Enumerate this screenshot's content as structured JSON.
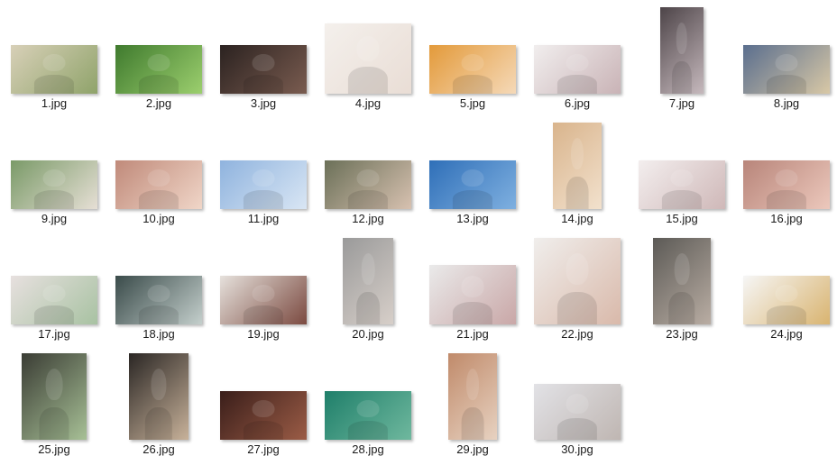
{
  "files": [
    {
      "name": "1.jpg",
      "orientation": "landscape",
      "colors": [
        "#d8d0b8",
        "#8fa36a"
      ]
    },
    {
      "name": "2.jpg",
      "orientation": "landscape",
      "colors": [
        "#3f7a2e",
        "#9ccf6e"
      ]
    },
    {
      "name": "3.jpg",
      "orientation": "landscape",
      "colors": [
        "#2b2220",
        "#7a5c50"
      ]
    },
    {
      "name": "4.jpg",
      "orientation": "landscape",
      "colors": [
        "#f4f0ec",
        "#e9ddd5"
      ]
    },
    {
      "name": "5.jpg",
      "orientation": "landscape",
      "colors": [
        "#e39a3a",
        "#f5d9b8"
      ]
    },
    {
      "name": "6.jpg",
      "orientation": "landscape",
      "colors": [
        "#f1eeee",
        "#c9b3b6"
      ]
    },
    {
      "name": "7.jpg",
      "orientation": "portrait",
      "colors": [
        "#4d4448",
        "#c6b9bd"
      ]
    },
    {
      "name": "8.jpg",
      "orientation": "landscape",
      "colors": [
        "#5a6e8e",
        "#d8c8a6"
      ]
    },
    {
      "name": "9.jpg",
      "orientation": "landscape",
      "colors": [
        "#7a9a68",
        "#e6dfd5"
      ]
    },
    {
      "name": "10.jpg",
      "orientation": "landscape",
      "colors": [
        "#c08a7a",
        "#f0d6c8"
      ]
    },
    {
      "name": "11.jpg",
      "orientation": "landscape",
      "colors": [
        "#8fb3de",
        "#d9e6f4"
      ]
    },
    {
      "name": "12.jpg",
      "orientation": "landscape",
      "colors": [
        "#6b7058",
        "#d7c1b0"
      ]
    },
    {
      "name": "13.jpg",
      "orientation": "landscape",
      "colors": [
        "#2f6fb8",
        "#7fb0e0"
      ]
    },
    {
      "name": "14.jpg",
      "orientation": "portrait",
      "colors": [
        "#d9b48c",
        "#f2e1cd"
      ]
    },
    {
      "name": "15.jpg",
      "orientation": "landscape",
      "colors": [
        "#f3eeee",
        "#cfb8b8"
      ]
    },
    {
      "name": "16.jpg",
      "orientation": "landscape",
      "colors": [
        "#b8857a",
        "#ecc8bc"
      ]
    },
    {
      "name": "17.jpg",
      "orientation": "landscape",
      "colors": [
        "#e7e0df",
        "#a8c2a2"
      ]
    },
    {
      "name": "18.jpg",
      "orientation": "landscape",
      "colors": [
        "#3a4b4a",
        "#c4cfcc"
      ]
    },
    {
      "name": "19.jpg",
      "orientation": "landscape",
      "colors": [
        "#e6e1dc",
        "#7b4a40"
      ]
    },
    {
      "name": "20.jpg",
      "orientation": "portrait",
      "colors": [
        "#9a9a9a",
        "#d7cfc9"
      ]
    },
    {
      "name": "21.jpg",
      "orientation": "landscape",
      "colors": [
        "#eaeaea",
        "#c9a7a7"
      ]
    },
    {
      "name": "22.jpg",
      "orientation": "landscape",
      "colors": [
        "#f0eeec",
        "#d9b9aa"
      ]
    },
    {
      "name": "23.jpg",
      "orientation": "portrait",
      "colors": [
        "#5c5a56",
        "#b9ada3"
      ]
    },
    {
      "name": "24.jpg",
      "orientation": "landscape",
      "colors": [
        "#f6f6f6",
        "#d9b470"
      ]
    },
    {
      "name": "25.jpg",
      "orientation": "portrait",
      "colors": [
        "#3a3c34",
        "#a7c096"
      ]
    },
    {
      "name": "26.jpg",
      "orientation": "portrait",
      "colors": [
        "#2a2624",
        "#c8b29a"
      ]
    },
    {
      "name": "27.jpg",
      "orientation": "landscape",
      "colors": [
        "#3a1e1a",
        "#9b5c46"
      ]
    },
    {
      "name": "28.jpg",
      "orientation": "landscape",
      "colors": [
        "#1f7f6a",
        "#6fb89e"
      ]
    },
    {
      "name": "29.jpg",
      "orientation": "portrait",
      "colors": [
        "#c08a6a",
        "#e7d2c1"
      ]
    },
    {
      "name": "30.jpg",
      "orientation": "landscape",
      "colors": [
        "#e2e2e6",
        "#bfb6b2"
      ]
    }
  ]
}
